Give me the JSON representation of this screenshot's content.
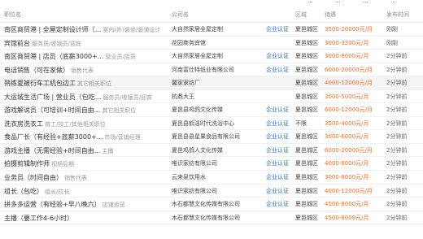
{
  "header": {
    "title_col": "职位名",
    "company_col": "公司名",
    "area_col": "区域",
    "salary_col": "待遇",
    "time_col": "发布时间"
  },
  "top_fragments": [
    "...",
    "...",
    "...",
    "..."
  ],
  "rows": [
    {
      "title": "南区商贸港 | 全屋定制设计师（...",
      "tag": "室内(外)装修/装潢设计",
      "company": "大自然家居全屋定制",
      "cert": "企业认证",
      "area": "夏邑城区",
      "salary": "3500-20000元/月",
      "time": "刚刚"
    },
    {
      "title": "宾馆前台",
      "tag": "服务员/收银员/迎宾",
      "company": "花园商务宾馆",
      "cert": "",
      "area": "夏邑城区",
      "salary": "3000-3200元/月",
      "time": "刚刚"
    },
    {
      "title": "南区商贸港 | 店员（底薪3000+...",
      "tag": "营业员/店员",
      "company": "大自然家居全屋定制",
      "cert": "企业认证",
      "area": "夏邑城区",
      "salary": "3000-8000元/月",
      "time": "2分钟前"
    },
    {
      "title": "电话销售（可在家做）",
      "tag": "销售代表",
      "company": "河南富仕特纸业有限公司",
      "cert": "企业认证",
      "area": "夏邑城区",
      "salary": "6000-20000元/月",
      "time": "2分钟前"
    },
    {
      "title": "熟练夏被衍车工机包边工",
      "tag": "其它相关职位",
      "company": "馨家家纺厂",
      "cert": "",
      "area": "夏邑城区",
      "salary": "4000-12000元/月",
      "time": "2分钟前"
    },
    {
      "title": "大运城生活广场 | 营业员（包吃...",
      "tag": "服务员/收银员/迎宾",
      "company": "杭鼎大王",
      "cert": "",
      "area": "夏邑城区",
      "salary": "3000-5000元/月",
      "time": "2分钟前"
    },
    {
      "title": "游戏解说员（可培训+时间自由...",
      "tag": "其它相关职位",
      "company": "夏邑县鸡鸽文化传媒",
      "cert": "企业认证",
      "area": "夏邑城区",
      "salary": "6000-12000元/月",
      "time": "2分钟前"
    },
    {
      "title": "洗衣房洗衣工",
      "tag": "普工/技工/其他相关职位",
      "company": "夏邑县鹤洁时代洗浴中心",
      "cert": "企业认证",
      "area": "不限",
      "salary": "3500-4000元/月",
      "time": "2分钟前"
    },
    {
      "title": "食品厂长（有经验+底薪3000+...",
      "tag": "市场/营销经理",
      "company": "夏邑县县星果食品有限公司",
      "cert": "企业认证",
      "area": "夏邑城区",
      "salary": "3000-6000元/月",
      "time": "2分钟前"
    },
    {
      "title": "游戏主播（无需经验+时间自由...",
      "tag": "主播",
      "company": "夏邑鸡鸽人文化传媒",
      "cert": "企业认证",
      "area": "夏邑城区",
      "salary": "6000-20000元/月",
      "time": "2分钟前"
    },
    {
      "title": "拍摄剪辑制作师",
      "tag": "视频后期",
      "company": "唯识家纺有限公司",
      "cert": "企业认证",
      "area": "夏邑城区",
      "salary": "4000-8000元/月",
      "time": "2分钟前"
    },
    {
      "title": "业务员（时间自由）",
      "tag": "销售代表",
      "company": "云来泉饮用水",
      "cert": "企业认证",
      "area": "夏邑城区",
      "salary": "3000-8000元/月",
      "time": "2分钟前"
    },
    {
      "title": "组长（包吃）",
      "tag": "组长/拉长",
      "company": "唯识家纺有限公司",
      "cert": "企业认证",
      "area": "夏邑城区",
      "salary": "4000-12000元/月",
      "time": "2分钟前"
    },
    {
      "title": "拼多多运营（有经验+早八晚六）",
      "tag": "店铺运营",
      "company": "木石都慧文化传媒有限公司",
      "cert": "企业认证",
      "area": "夏邑城区",
      "salary": "4500-8000元/月",
      "time": "2分钟前"
    },
    {
      "title": "主播（要工作4-6小时）",
      "tag": "",
      "company": "木石都慧文化传媒有限公司",
      "cert": "",
      "area": "夏邑城区",
      "salary": "4500-8000元/月",
      "time": "2分钟前"
    }
  ]
}
